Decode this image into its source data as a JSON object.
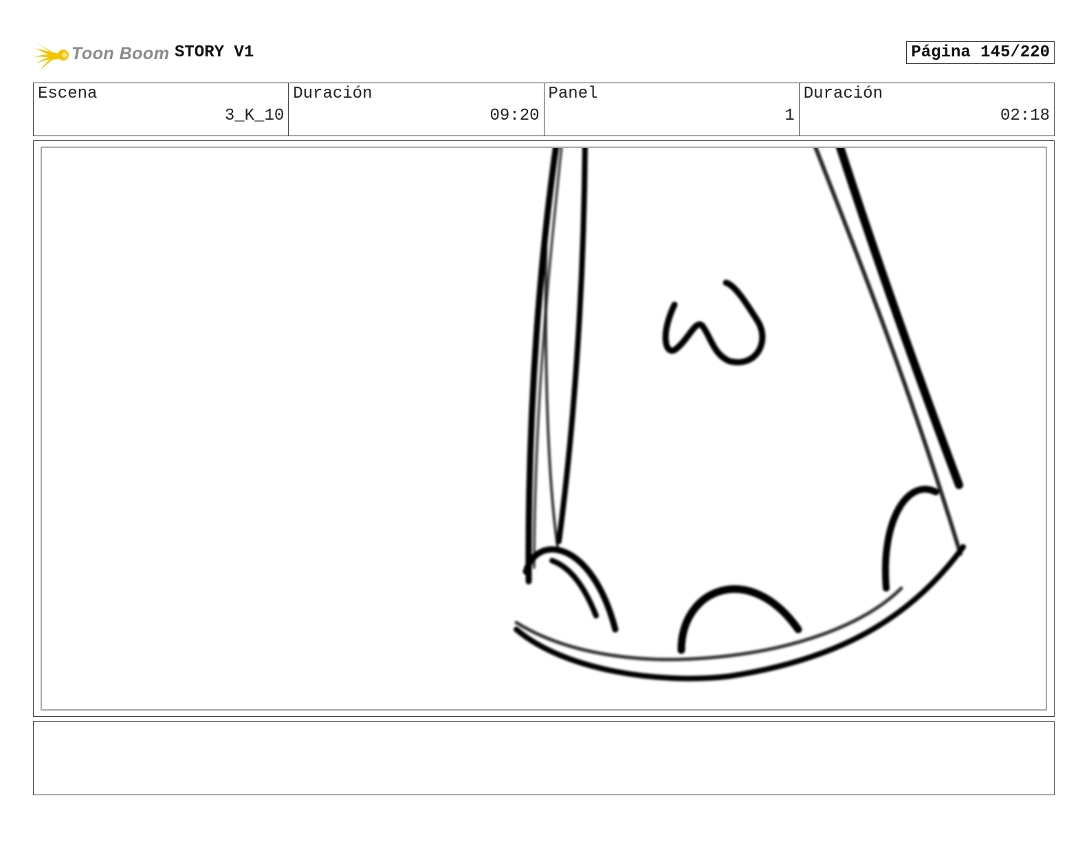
{
  "header": {
    "logo_text": "Toon Boom",
    "project_title": "STORY V1",
    "page_label": "Página 145/220"
  },
  "info": [
    {
      "label": "Escena",
      "value": "3_K_10"
    },
    {
      "label": "Duración",
      "value": "09:20"
    },
    {
      "label": "Panel",
      "value": "1"
    },
    {
      "label": "Duración",
      "value": "02:18"
    }
  ],
  "colors": {
    "logo_star": "#f5c400",
    "logo_text": "#8a8a8a",
    "stroke": "#000000",
    "frame_border": "#aaaaaa"
  },
  "icons": {
    "logo": "toon-boom-star-icon"
  }
}
